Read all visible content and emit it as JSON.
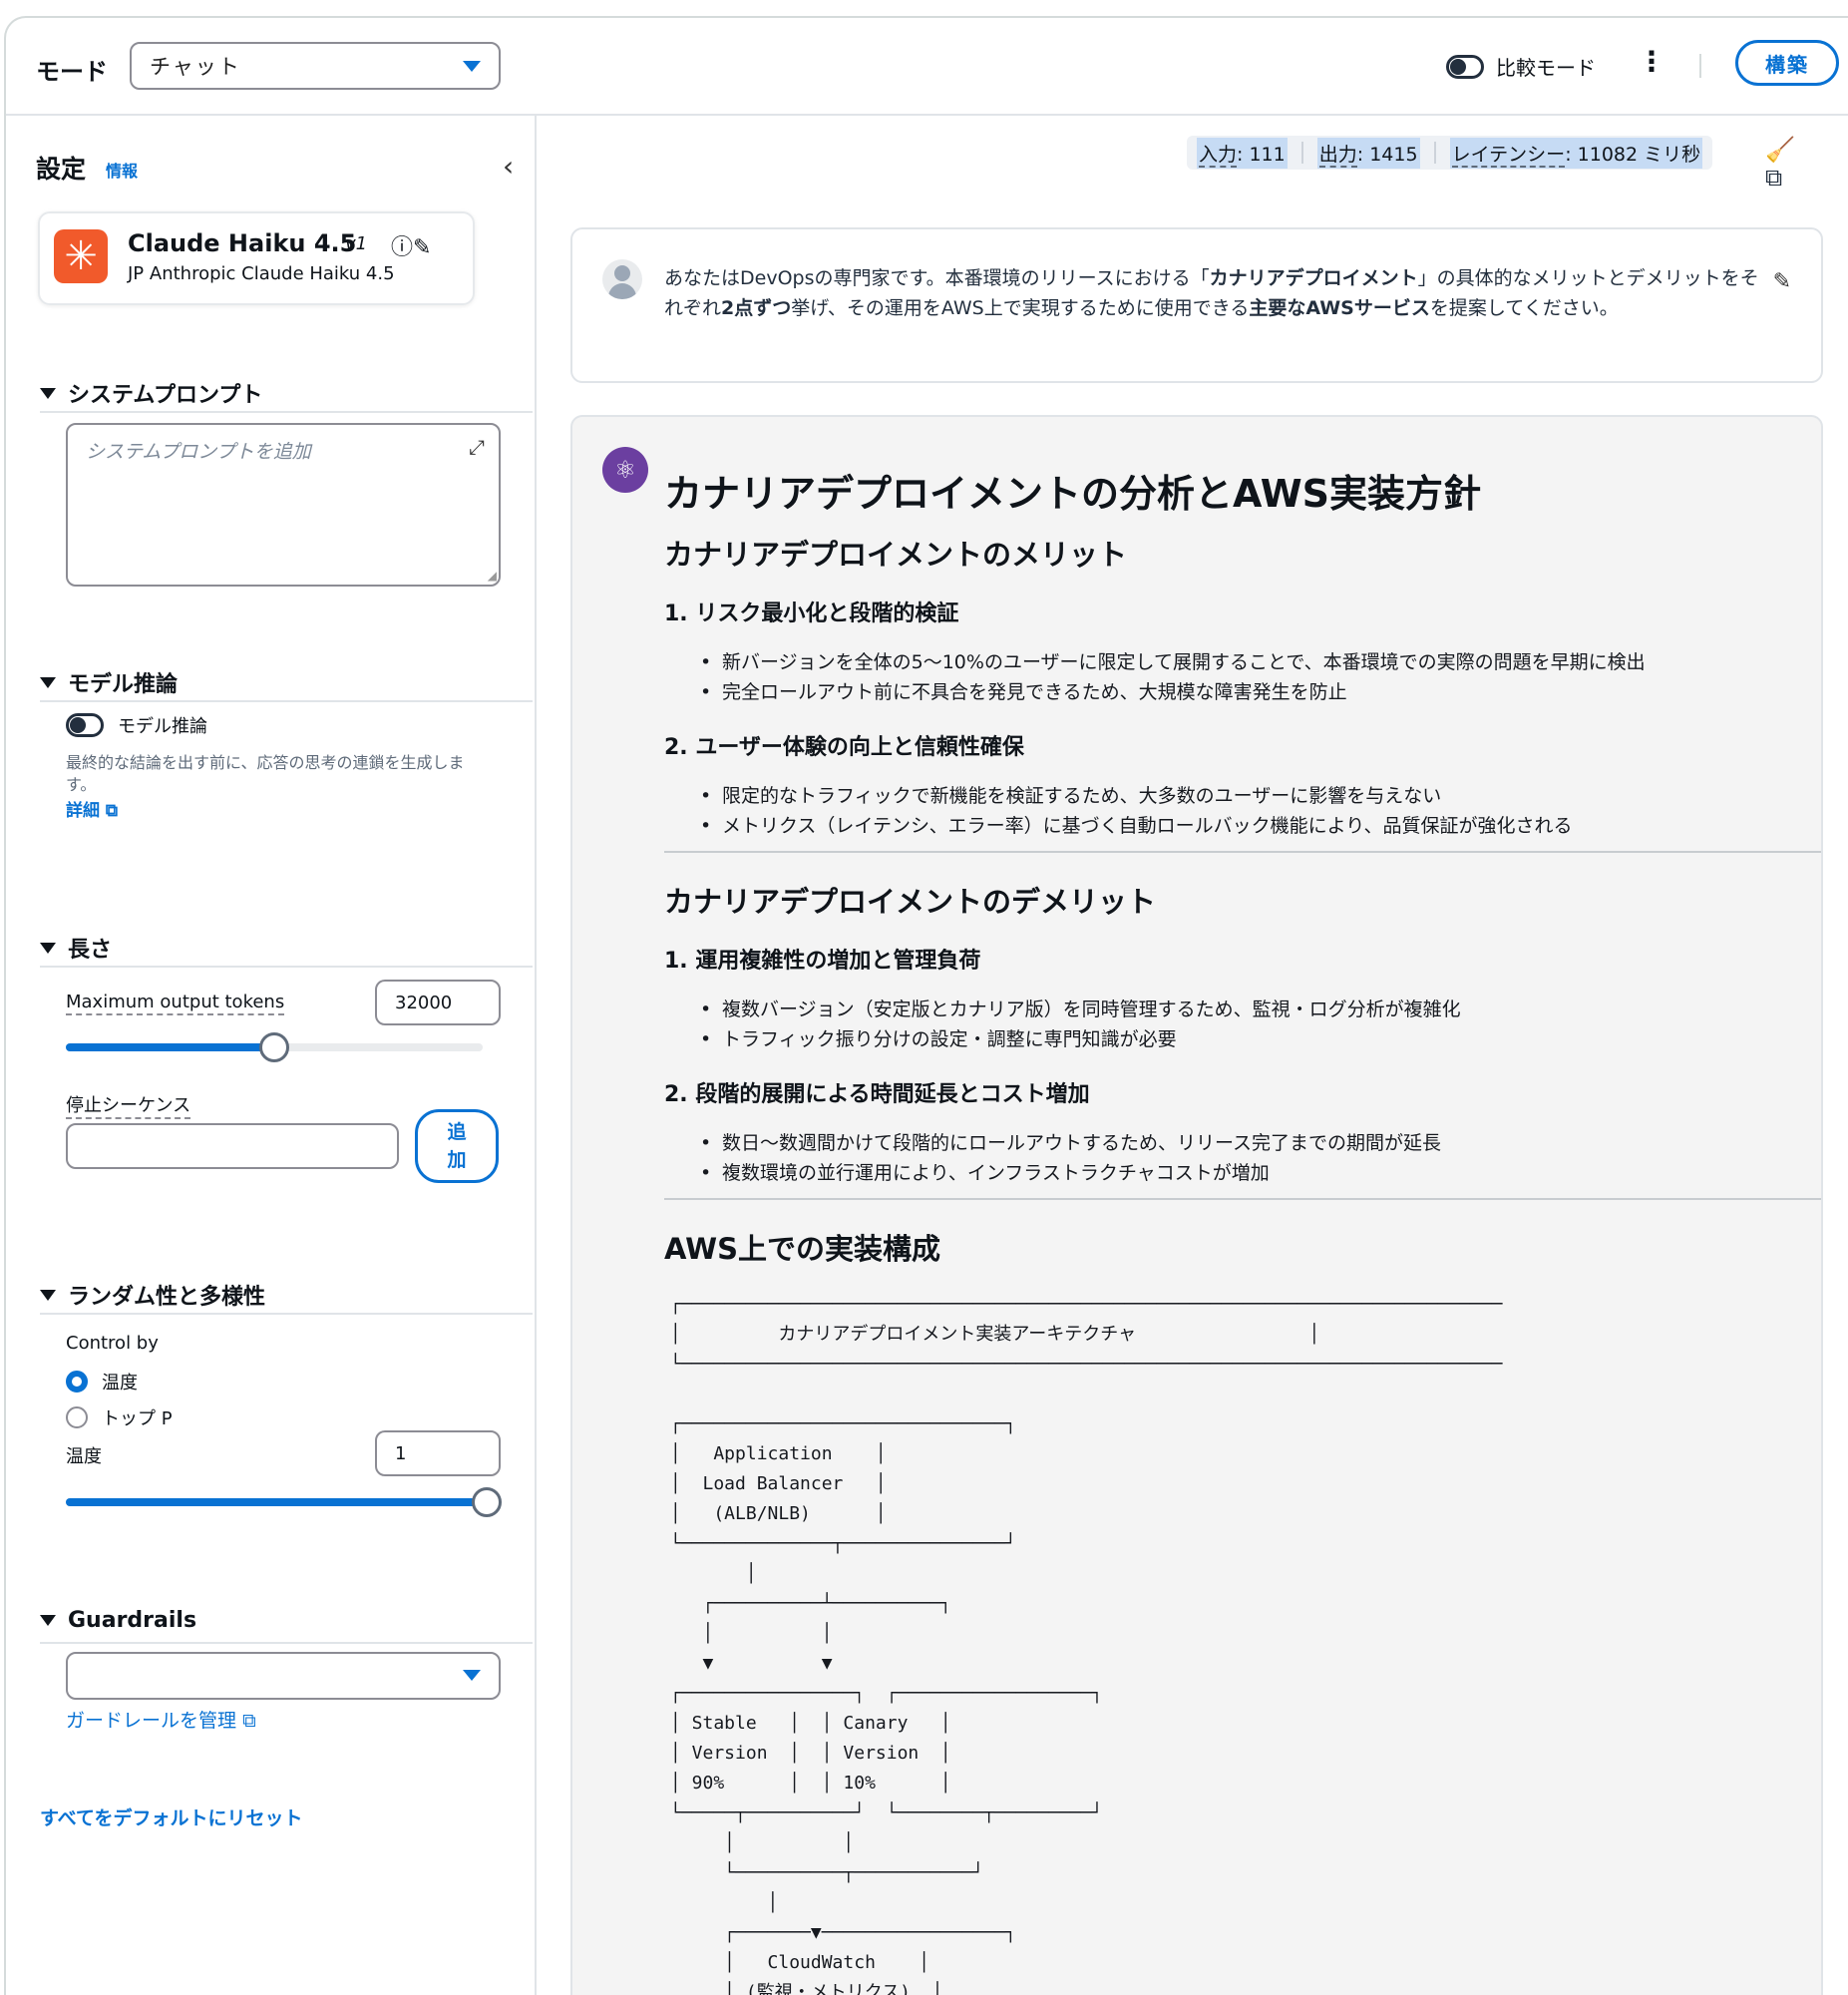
{
  "topbar": {
    "mode_label": "モード",
    "mode_value": "チャット",
    "compare_label": "比較モード",
    "build_label": "構築"
  },
  "settings": {
    "title": "設定",
    "info": "情報",
    "model": {
      "name": "Claude Haiku 4.5",
      "version": "v1",
      "provider": "JP Anthropic Claude Haiku 4.5"
    },
    "system_prompt": {
      "header": "システムプロンプト",
      "placeholder": "システムプロンプトを追加"
    },
    "reasoning": {
      "header": "モデル推論",
      "toggle_label": "モデル推論",
      "description": "最終的な結論を出す前に、応答の思考の連鎖を生成します。",
      "details_link": "詳細"
    },
    "length": {
      "header": "長さ",
      "max_tokens_label": "Maximum output tokens",
      "max_tokens_value": "32000",
      "max_tokens_fraction": 0.5,
      "stop_seq_label": "停止シーケンス",
      "add_label": "追加"
    },
    "randomness": {
      "header": "ランダム性と多様性",
      "control_by": "Control by",
      "option_temperature": "温度",
      "option_top_p": "トップ P",
      "temperature_label": "温度",
      "temperature_value": "1",
      "temperature_fraction": 1.0
    },
    "guardrails": {
      "header": "Guardrails",
      "manage_link": "ガードレールを管理"
    },
    "reset_link": "すべてをデフォルトにリセット"
  },
  "stats": {
    "input_label": "入力",
    "input_value": "111",
    "output_label": "出力",
    "output_value": "1415",
    "latency_label": "レイテンシー",
    "latency_value": "11082 ミリ秒"
  },
  "prompt": {
    "text_1": "あなたはDevOpsの専門家です。本番環境のリリースにおける「",
    "bold_1": "カナリアデプロイメント",
    "text_2": "」の具体的なメリットとデメリットをそれぞれ",
    "bold_2": "2点ずつ",
    "text_3": "挙げ、その運用をAWS上で実現するために使用できる",
    "bold_3": "主要なAWSサービス",
    "text_4": "を提案してください。"
  },
  "response": {
    "title": "カナリアデプロイメントの分析とAWS実装方針",
    "merits_header": "カナリアデプロイメントのメリット",
    "merit1_title": "1. リスク最小化と段階的検証",
    "merit1_b1": "新バージョンを全体の5〜10%のユーザーに限定して展開することで、本番環境での実際の問題を早期に検出",
    "merit1_b2": "完全ロールアウト前に不具合を発見できるため、大規模な障害発生を防止",
    "merit2_title": "2. ユーザー体験の向上と信頼性確保",
    "merit2_b1": "限定的なトラフィックで新機能を検証するため、大多数のユーザーに影響を与えない",
    "merit2_b2": "メトリクス（レイテンシ、エラー率）に基づく自動ロールバック機能により、品質保証が強化される",
    "demerits_header": "カナリアデプロイメントのデメリット",
    "demerit1_title": "1. 運用複雑性の増加と管理負荷",
    "demerit1_b1": "複数バージョン（安定版とカナリア版）を同時管理するため、監視・ログ分析が複雑化",
    "demerit1_b2": "トラフィック振り分けの設定・調整に専門知識が必要",
    "demerit2_title": "2. 段階的展開による時間延長とコスト増加",
    "demerit2_b1": "数日〜数週間かけて段階的にロールアウトするため、リリース完了までの期間が延長",
    "demerit2_b2": "複数環境の並行運用により、インフラストラクチャコストが増加",
    "aws_header": "AWS上での実装構成",
    "diagram": "┌────────────────────────────────────────────────────────────────────────────\n│         カナリアデプロイメント実装アーキテクチャ                │\n└────────────────────────────────────────────────────────────────────────────\n\n┌──────────────────────────────┐\n│   Application    │\n│  Load Balancer   │\n│   (ALB/NLB)      │\n└──────────────┬───────────────┘\n       │\n   ┌──────────┴──────────┐\n   │          │\n   ▼          ▼\n┌────────────────┐  ┌──────────────────┐\n│ Stable   │  │ Canary   │\n│ Version  │  │ Version  │\n│ 90%      │  │ 10%      │\n└─────┬──────────┘  └────────┬─────────┘\n     │          │\n     └──────────┬───────────┘\n         │\n     ┌───────▼─────────────────┐\n     │   CloudWatch    │\n     │ (監視・メトリクス)  │"
  }
}
